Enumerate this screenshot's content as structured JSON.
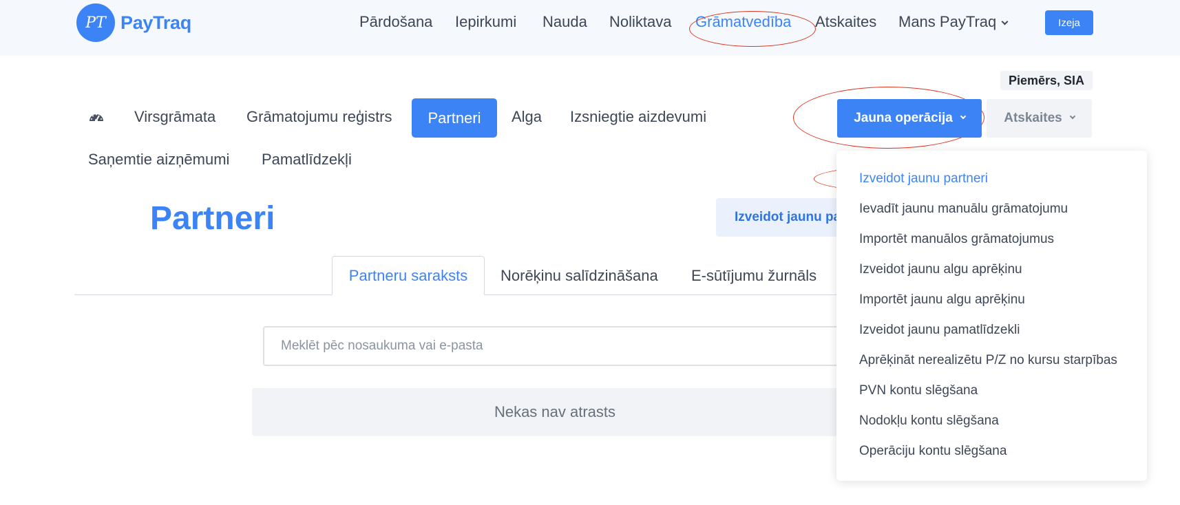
{
  "app": {
    "logo_text": "PayTraq",
    "logo_monogram": "PT"
  },
  "topnav": {
    "items": [
      {
        "label": "Pārdošana"
      },
      {
        "label": "Iepirkumi"
      },
      {
        "label": "Nauda"
      },
      {
        "label": "Noliktava"
      },
      {
        "label": "Grāmatvedība",
        "active": true
      },
      {
        "label": "Atskaites"
      },
      {
        "label": "Mans PayTraq",
        "has_dropdown": true
      }
    ],
    "logout_label": "Izeja"
  },
  "company": {
    "name": "Piemērs, SIA"
  },
  "subnav": {
    "dashboard_icon": "gauge-icon",
    "items": [
      {
        "label": "Virsgrāmata"
      },
      {
        "label": "Grāmatojumu reģistrs"
      },
      {
        "label": "Partneri",
        "active": true
      },
      {
        "label": "Alga"
      },
      {
        "label": "Izsniegtie aizdevumi"
      },
      {
        "label": "Saņemtie aizņēmumi"
      },
      {
        "label": "Pamatlīdzekļi"
      }
    ]
  },
  "actions": {
    "new_operation_label": "Jauna operācija",
    "reports_label": "Atskaites"
  },
  "page": {
    "title": "Partneri",
    "create_button_label": "Izveidot jaunu pa"
  },
  "tabs": [
    {
      "label": "Partneru saraksts",
      "active": true
    },
    {
      "label": "Norēķinu salīdzināšana"
    },
    {
      "label": "E-sūtījumu žurnāls"
    }
  ],
  "search": {
    "placeholder": "Meklēt pēc nosaukuma vai e-pasta",
    "value": ""
  },
  "empty_state": {
    "message": "Nekas nav atrasts"
  },
  "dropdown": {
    "items": [
      {
        "label": "Izveidot jaunu partneri",
        "highlighted": true
      },
      {
        "label": "Ievadīt jaunu manuālu grāmatojumu"
      },
      {
        "label": "Importēt manuālos grāmatojumus"
      },
      {
        "label": "Izveidot jaunu algu aprēķinu"
      },
      {
        "label": "Importēt jaunu algu aprēķinu"
      },
      {
        "label": "Izveidot jaunu pamatlīdzekli"
      },
      {
        "label": "Aprēķināt nerealizētu P/Z no kursu starpības"
      },
      {
        "label": "PVN kontu slēgšana"
      },
      {
        "label": "Nodokļu kontu slēgšana"
      },
      {
        "label": "Operāciju kontu slēgšana"
      }
    ]
  },
  "colors": {
    "brand_blue": "#3c84f6",
    "annotation_red": "#e0331c",
    "topbar_bg": "#f5f8fc"
  }
}
